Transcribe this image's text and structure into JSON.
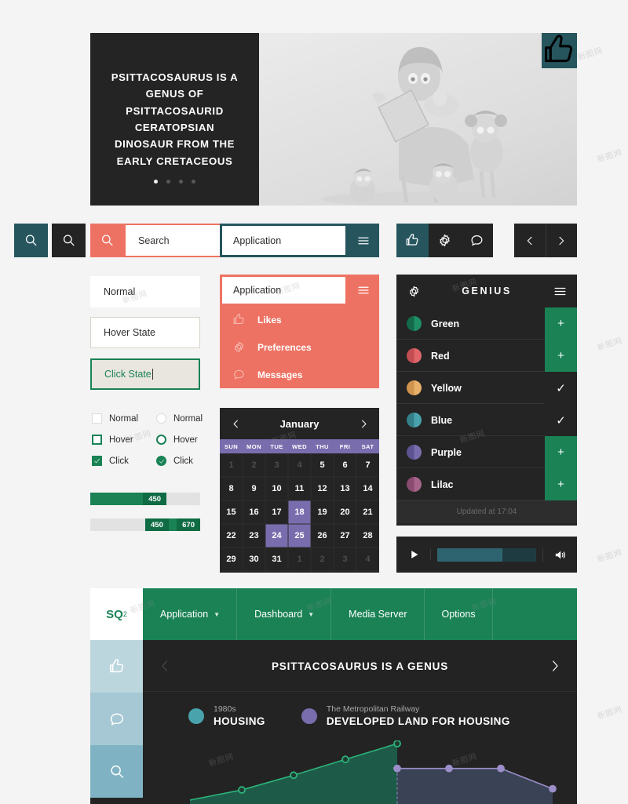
{
  "hero": {
    "headline": "PSITTACOSAURUS IS A GENUS OF PSITTACOSAURID CERATOPSIAN DINOSAUR FROM THE EARLY CRETACEOUS",
    "dots": 4,
    "active_dot": 0,
    "like_icon": "thumbs-up-icon"
  },
  "button_row": {
    "search_teal_icon": "search-icon",
    "search_dark_icon": "search-icon",
    "search_coral_icon": "search-icon",
    "search_placeholder": "Search",
    "app_value": "Application",
    "burger_icon": "hamburger-icon",
    "trio": [
      {
        "icon": "thumbs-up-icon",
        "selected": true
      },
      {
        "icon": "gear-icon",
        "selected": false
      },
      {
        "icon": "chat-bubble-icon",
        "selected": false
      }
    ],
    "prev_label": "‹",
    "next_label": "›"
  },
  "inputs": {
    "normal": "Normal",
    "hover": "Hover State",
    "click": "Click State"
  },
  "checkboxes": [
    {
      "label": "Normal",
      "state": "normal"
    },
    {
      "label": "Hover",
      "state": "hover"
    },
    {
      "label": "Click",
      "state": "click"
    }
  ],
  "radios": [
    {
      "label": "Normal",
      "state": "normal"
    },
    {
      "label": "Hover",
      "state": "hover"
    },
    {
      "label": "Click",
      "state": "click"
    }
  ],
  "progress": {
    "single": {
      "value": "450",
      "percent": 72
    },
    "range": {
      "low": "450",
      "high": "670",
      "start_percent": 50,
      "end_percent": 100
    }
  },
  "dropdown": {
    "field_value": "Application",
    "burger_icon": "hamburger-icon",
    "items": [
      {
        "label": "Likes",
        "icon": "thumbs-up-icon"
      },
      {
        "label": "Preferences",
        "icon": "gear-icon"
      },
      {
        "label": "Messages",
        "icon": "chat-bubble-icon"
      }
    ]
  },
  "calendar": {
    "month": "January",
    "prev_icon": "chevron-left-icon",
    "next_icon": "chevron-right-icon",
    "weekdays": [
      "SUN",
      "MON",
      "TUE",
      "WED",
      "THU",
      "FRI",
      "SAT"
    ],
    "cells": [
      {
        "d": "1",
        "muted": true
      },
      {
        "d": "2",
        "muted": true
      },
      {
        "d": "3",
        "muted": true
      },
      {
        "d": "4",
        "muted": true
      },
      {
        "d": "5"
      },
      {
        "d": "6"
      },
      {
        "d": "7"
      },
      {
        "d": "8"
      },
      {
        "d": "9"
      },
      {
        "d": "10"
      },
      {
        "d": "11"
      },
      {
        "d": "12"
      },
      {
        "d": "13"
      },
      {
        "d": "14"
      },
      {
        "d": "15"
      },
      {
        "d": "16"
      },
      {
        "d": "17"
      },
      {
        "d": "18",
        "selected": true
      },
      {
        "d": "19"
      },
      {
        "d": "20"
      },
      {
        "d": "21"
      },
      {
        "d": "22"
      },
      {
        "d": "23"
      },
      {
        "d": "24",
        "selected": true
      },
      {
        "d": "25",
        "selected": true
      },
      {
        "d": "26"
      },
      {
        "d": "27"
      },
      {
        "d": "28"
      },
      {
        "d": "29"
      },
      {
        "d": "30"
      },
      {
        "d": "31"
      },
      {
        "d": "1",
        "muted": true
      },
      {
        "d": "2",
        "muted": true
      },
      {
        "d": "3",
        "muted": true
      },
      {
        "d": "4",
        "muted": true
      }
    ]
  },
  "genius": {
    "title": "GENIUS",
    "gear_icon": "gear-icon",
    "burger_icon": "hamburger-icon",
    "items": [
      {
        "label": "Green",
        "color": "#1f8f66",
        "dark": "#14694a",
        "action": "add",
        "action_label": "+"
      },
      {
        "label": "Red",
        "color": "#e1666a",
        "dark": "#c24d52",
        "action": "add",
        "action_label": "+"
      },
      {
        "label": "Yellow",
        "color": "#e8b06a",
        "dark": "#cf934e",
        "action": "check",
        "action_label": "✓"
      },
      {
        "label": "Blue",
        "color": "#49a3ad",
        "dark": "#357f89",
        "action": "check",
        "action_label": "✓"
      },
      {
        "label": "Purple",
        "color": "#7a6dae",
        "dark": "#5d5292",
        "action": "add",
        "action_label": "+"
      },
      {
        "label": "Lilac",
        "color": "#a8658c",
        "dark": "#8a4b71",
        "action": "add",
        "action_label": "+"
      }
    ],
    "footer": "Updated at 17:04"
  },
  "player": {
    "play_icon": "play-icon",
    "volume_icon": "volume-icon",
    "progress_percent": 66
  },
  "bottom_app": {
    "logo": "SQ",
    "logo_sup": "2",
    "tabs": [
      {
        "label": "Application",
        "caret": true
      },
      {
        "label": "Dashboard",
        "caret": true
      },
      {
        "label": "Media Server",
        "caret": false
      },
      {
        "label": "Options",
        "caret": false
      }
    ],
    "rail": [
      {
        "icon": "thumbs-up-icon"
      },
      {
        "icon": "chat-bubble-icon"
      },
      {
        "icon": "search-icon"
      }
    ],
    "carousel": {
      "title": "PSITTACOSAURUS IS A GENUS",
      "prev_icon": "chevron-left-icon",
      "next_icon": "chevron-right-icon"
    },
    "legend": [
      {
        "sub": "1980s",
        "big": "HOUSING",
        "color": "#49a3ad"
      },
      {
        "sub": "The Metropolitan Railway",
        "big": "DEVELOPED LAND FOR HOUSING",
        "color": "#7a6dae"
      }
    ]
  },
  "chart_data": {
    "type": "area",
    "title": "",
    "xlabel": "",
    "ylabel": "",
    "grid": false,
    "legend_position": "top",
    "series": [
      {
        "name": "HOUSING",
        "color": "#2db37a",
        "fill": "#1e5f4b",
        "x": [
          0,
          1,
          2,
          3,
          4
        ],
        "values": [
          0,
          18,
          44,
          72,
          100
        ]
      },
      {
        "name": "DEVELOPED LAND FOR HOUSING",
        "color": "#9b8ec9",
        "fill": "#3c4459",
        "x": [
          4,
          5,
          6,
          7
        ],
        "values": [
          56,
          56,
          56,
          20
        ]
      }
    ],
    "ylim": [
      0,
      100
    ]
  },
  "watermarks": [
    "新图网"
  ]
}
